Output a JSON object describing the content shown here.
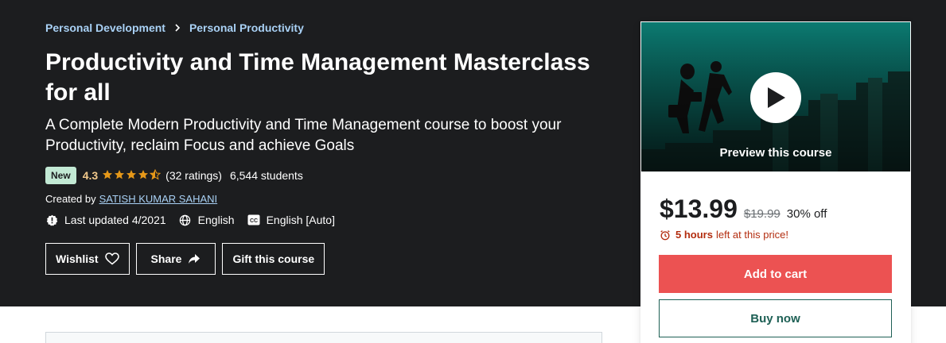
{
  "breadcrumb": {
    "items": [
      "Personal Development",
      "Personal Productivity"
    ]
  },
  "course": {
    "title": "Productivity and Time Management Masterclass for all",
    "subtitle": "A Complete Modern Productivity and Time Management course to boost your Productivity, reclaim Focus and achieve Goals",
    "badge": "New",
    "rating": "4.3",
    "rating_stars": 4.3,
    "ratings_count": "(32 ratings)",
    "students": "6,544 students",
    "created_by_label": "Created by",
    "author": "SATISH KUMAR SAHANI",
    "last_updated": "Last updated 4/2021",
    "language": "English",
    "captions": "English [Auto]"
  },
  "actions": {
    "wishlist": "Wishlist",
    "share": "Share",
    "gift": "Gift this course"
  },
  "sidebar": {
    "preview_label": "Preview this course",
    "price": "$13.99",
    "original_price": "$19.99",
    "discount": "30% off",
    "timer_bold": "5 hours",
    "timer_rest": "left at this price!",
    "add_to_cart": "Add to cart",
    "buy_now": "Buy now"
  },
  "colors": {
    "hero_bg": "#1c1d1f",
    "link": "#a9d1f5",
    "star": "#e59819",
    "cart": "#ec5252",
    "buy_border": "#1e6055",
    "timer": "#b32d0f"
  },
  "icons": {
    "breadcrumb_sep": "chevron-right-icon",
    "updated": "alert-badge-icon",
    "language": "globe-icon",
    "captions": "closed-caption-icon",
    "wishlist": "heart-icon",
    "share": "share-arrow-icon",
    "timer": "alarm-clock-icon",
    "play": "play-icon"
  }
}
